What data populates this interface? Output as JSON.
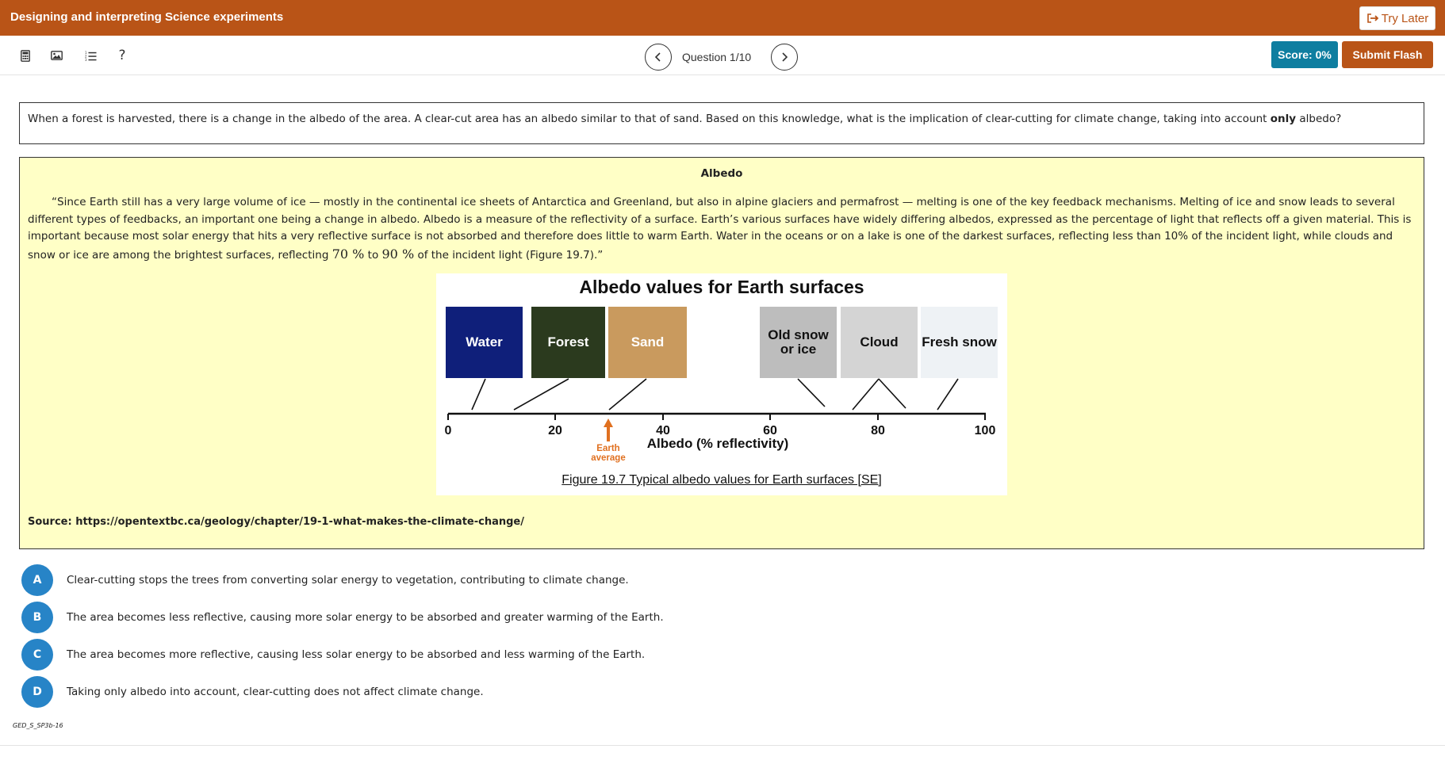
{
  "header": {
    "title": "Designing and interpreting Science experiments",
    "try_later_label": "Try Later"
  },
  "toolbar": {
    "icons": [
      "calculator-icon",
      "image-icon",
      "list-icon",
      "help-icon"
    ],
    "help_glyph": "?",
    "question_label": "Question 1/10",
    "score_label": "Score: 0%",
    "submit_label": "Submit Flash"
  },
  "question": {
    "text_before": "When a forest is harvested, there is a change in the albedo of the area. A clear-cut area has an albedo similar to that of sand. Based on this knowledge, what is the implication of clear-cutting for climate change, taking into account ",
    "text_bold": "only",
    "text_after": " albedo?"
  },
  "passage": {
    "title": "Albedo",
    "text_main": "“Since Earth still has a very large volume of ice — mostly in the continental ice sheets of Antarctica and Greenland, but also in alpine glaciers and permafrost — melting is one of the key feedback mechanisms. Melting of ice and snow leads to several different types of feedbacks, an important one being a change in albedo. Albedo is a measure of the reflectivity of a surface. Earth’s various surfaces have widely differing albedos, expressed as the percentage of light that reflects off a given material. This is important because most solar energy that hits a very reflective surface is not absorbed and therefore does little to warm Earth. Water in the oceans or on a lake is one of the darkest surfaces, reflecting less than 10% of the incident light, while clouds and snow or ice are among the brightest surfaces, reflecting ",
    "math_1": "70 %",
    "text_to": " to ",
    "math_2": "90 %",
    "text_end": " of the incident light (Figure 19.7).”",
    "source": "Source: https://opentextbc.ca/geology/chapter/19-1-what-makes-the-climate-change/"
  },
  "figure": {
    "title": "Albedo values for Earth surfaces",
    "surfaces": [
      {
        "label": "Water",
        "color": "#0f1f7a",
        "text_color": "#ffffff"
      },
      {
        "label": "Forest",
        "color": "#2b3a1e",
        "text_color": "#ffffff"
      },
      {
        "label": "Sand",
        "color": "#c99a5e",
        "text_color": "#ffffff"
      },
      {
        "label": "Old snow or ice",
        "color": "#bdbdbd",
        "text_color": "#111111"
      },
      {
        "label": "Cloud",
        "color": "#d4d4d4",
        "text_color": "#111111"
      },
      {
        "label": "Fresh snow",
        "color": "#eef2f5",
        "text_color": "#111111"
      }
    ],
    "axis_ticks": [
      "0",
      "20",
      "40",
      "60",
      "80",
      "100"
    ],
    "axis_label": "Albedo (% reflectivity)",
    "marker_label": "Earth average",
    "marker_color": "#e07020",
    "caption": "Figure 19.7 Typical albedo values for Earth surfaces [SE]"
  },
  "options": [
    {
      "letter": "A",
      "text": "Clear-cutting stops the trees from converting solar energy to vegetation, contributing to climate change."
    },
    {
      "letter": "B",
      "text": "The area becomes less reflective, causing more solar energy to be absorbed and greater warming of the Earth."
    },
    {
      "letter": "C",
      "text": "The area becomes more reflective, causing less solar energy to be absorbed and less warming of the Earth."
    },
    {
      "letter": "D",
      "text": "Taking only albedo into account, clear-cutting does not affect climate change."
    }
  ],
  "item_code": "GED_S_SP3b-16"
}
